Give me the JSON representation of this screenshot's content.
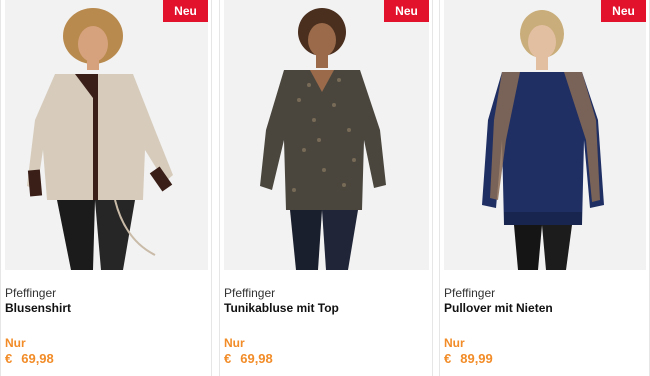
{
  "products": [
    {
      "badge": "Neu",
      "brand": "Pfeffinger",
      "name": "Blusenshirt",
      "price_prefix": "Nur",
      "currency": "€",
      "price": "69,98"
    },
    {
      "badge": "Neu",
      "brand": "Pfeffinger",
      "name": "Tunikabluse mit Top",
      "price_prefix": "Nur",
      "currency": "€",
      "price": "69,98"
    },
    {
      "badge": "Neu",
      "brand": "Pfeffinger",
      "name": "Pullover mit Nieten",
      "price_prefix": "Nur",
      "currency": "€",
      "price": "89,99"
    }
  ],
  "colors": {
    "badge": "#e3122c",
    "price": "#f28c28",
    "image_bg": "#f2f2f2"
  }
}
